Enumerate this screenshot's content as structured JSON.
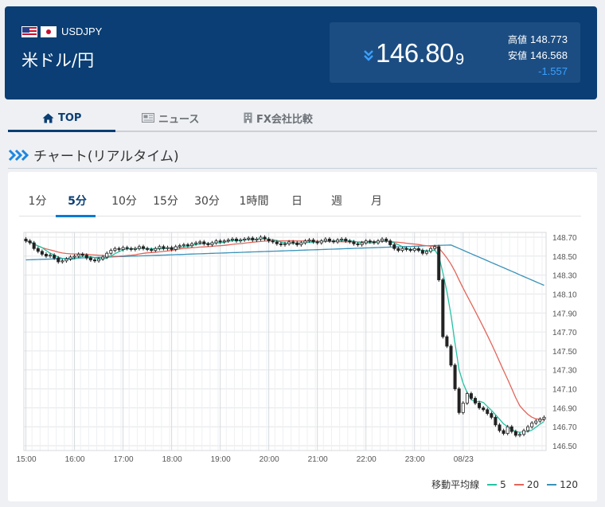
{
  "header": {
    "pair_code": "USDJPY",
    "pair_name": "米ドル/円",
    "price_main": "146.80",
    "price_small": "9",
    "high_label": "高値",
    "high_value": "148.773",
    "low_label": "安値",
    "low_value": "146.568",
    "change": "-1.557",
    "down_color": "#3aa0ff",
    "icons": [
      "us-flag-icon",
      "jp-flag-icon",
      "double-chevron-down-icon"
    ]
  },
  "tabs": [
    {
      "label": "TOP",
      "icon": "home-icon",
      "active": true
    },
    {
      "label": "ニュース",
      "icon": "newspaper-icon",
      "active": false
    },
    {
      "label": "FX会社比較",
      "icon": "building-icon",
      "active": false
    }
  ],
  "section": {
    "title": "チャート(リアルタイム)",
    "icon": "triple-chevron-right-icon"
  },
  "periods": [
    {
      "label": "1分",
      "active": false
    },
    {
      "label": "5分",
      "active": true
    },
    {
      "label": "10分",
      "active": false
    },
    {
      "label": "15分",
      "active": false
    },
    {
      "label": "30分",
      "active": false
    },
    {
      "label": "1時間",
      "active": false
    },
    {
      "label": "日",
      "active": false
    },
    {
      "label": "週",
      "active": false
    },
    {
      "label": "月",
      "active": false
    }
  ],
  "chart_data": {
    "type": "candlestick",
    "x_ticks": [
      "15:00",
      "16:00",
      "17:00",
      "18:00",
      "19:00",
      "20:00",
      "21:00",
      "22:00",
      "23:00",
      "08/23"
    ],
    "y_ticks": [
      "148.70",
      "148.50",
      "148.30",
      "148.10",
      "147.90",
      "147.70",
      "147.50",
      "147.30",
      "147.10",
      "146.90",
      "146.70",
      "146.50"
    ],
    "ylim": [
      146.45,
      148.75
    ],
    "grid": true,
    "legend_position": "bottom-right",
    "legend_title": "移動平均線",
    "ma_series": [
      {
        "name": "5",
        "color": "#27c2a3"
      },
      {
        "name": "20",
        "color": "#e2655b"
      },
      {
        "name": "120",
        "color": "#3a92b8"
      }
    ],
    "closes": [
      148.66,
      148.64,
      148.58,
      148.55,
      148.52,
      148.5,
      148.51,
      148.48,
      148.44,
      148.45,
      148.47,
      148.49,
      148.5,
      148.52,
      148.51,
      148.48,
      148.46,
      148.45,
      148.47,
      148.49,
      148.53,
      148.56,
      148.58,
      148.57,
      148.59,
      148.58,
      148.57,
      148.58,
      148.6,
      148.58,
      148.57,
      148.56,
      148.58,
      148.6,
      148.58,
      148.59,
      148.57,
      148.6,
      148.61,
      148.62,
      148.61,
      148.63,
      148.64,
      148.65,
      148.63,
      148.62,
      148.64,
      148.66,
      148.65,
      148.66,
      148.67,
      148.68,
      148.66,
      148.67,
      148.68,
      148.69,
      148.67,
      148.68,
      148.7,
      148.68,
      148.66,
      148.65,
      148.63,
      148.62,
      148.63,
      148.65,
      148.64,
      148.62,
      148.64,
      148.66,
      148.67,
      148.65,
      148.64,
      148.66,
      148.68,
      148.66,
      148.65,
      148.67,
      148.68,
      148.66,
      148.65,
      148.63,
      148.62,
      148.64,
      148.66,
      148.65,
      148.64,
      148.66,
      148.68,
      148.66,
      148.62,
      148.58,
      148.56,
      148.58,
      148.57,
      148.56,
      148.58,
      148.56,
      148.53,
      148.55,
      148.58,
      148.6,
      148.25,
      147.65,
      147.55,
      147.35,
      147.1,
      146.85,
      146.95,
      147.05,
      147.0,
      146.95,
      146.9,
      146.88,
      146.84,
      146.8,
      146.72,
      146.66,
      146.63,
      146.7,
      146.65,
      146.61,
      146.62,
      146.66,
      146.7,
      146.74,
      146.76,
      146.78,
      146.8
    ]
  },
  "colors": {
    "header_bg": "#0a3e74",
    "accent": "#0a3e74",
    "candle": "#222222",
    "grid": "#e4e6e9"
  }
}
